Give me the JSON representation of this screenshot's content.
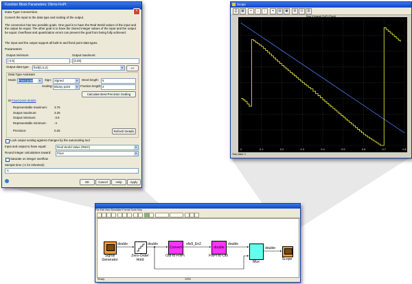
{
  "dialog": {
    "title": "Function Block Parameters: Obl-to-FixPt",
    "block_type": "Data Type Conversion",
    "description_1": "Convert the input to the data type and scaling of the output.",
    "description_2": "The conversion has two possible goals. One goal is to have the Real World values of the input and the output be equal. The other goal is to have the Stored Integer values of the input and the output be equal. Overflows and quantization errors can prevent the goal from being fully achieved.",
    "description_3": "The input and the output support all built-in and fixed point data types.",
    "parameters_label": "Parameters",
    "output_min_label": "Output minimum:",
    "output_min_value": "[-3.5]",
    "output_max_label": "Output maximum:",
    "output_max_value": "[3.25]",
    "data_type_label": "Output data type:",
    "data_type_value": "fixdt(1,5,2)",
    "data_type_btn": "<<",
    "assistant_label": "Data Type Assistant",
    "mode_label": "Mode:",
    "mode_value": "Fixed point",
    "sign_label": "Sign:",
    "sign_value": "Signed",
    "word_length_label": "Word length:",
    "word_length_value": "5",
    "scaling_label": "Scaling:",
    "scaling_value": "Binary point",
    "fraction_label": "Fraction length:",
    "fraction_value": "2",
    "calc_button": "Calculate Best-Precision Scaling",
    "fp_details_link": "Fixed-point details",
    "details": [
      {
        "label": "Representable maximum:",
        "value": "3.75"
      },
      {
        "label": "Output maximum:",
        "value": "3.25"
      },
      {
        "label": "Output minimum:",
        "value": "-3.5"
      },
      {
        "label": "Representable minimum:",
        "value": "-4"
      }
    ],
    "precision_label": "Precision:",
    "precision_value": "0.25",
    "refresh_button": "Refresh Details",
    "lock_label": "Lock output scaling against changes by the autoscaling tool",
    "equal_label": "Input and output to have equal:",
    "equal_value": "Real World Value (RWV)",
    "round_label": "Round integer calculations toward:",
    "round_value": "Floor",
    "saturate_label": "Saturate on integer overflow",
    "sample_label": "Sample time (-1 for inherited):",
    "sample_value": "-1",
    "ok": "OK",
    "cancel": "Cancel",
    "help": "Help",
    "apply": "Apply"
  },
  "scope": {
    "title": "Scope",
    "plot_title": "Real (Original)    FixPt (Fixed)"
  },
  "chart_data": {
    "type": "line",
    "title": "Real (Original)    FixPt (Fixed)",
    "xlim": [
      0,
      0.8
    ],
    "ylim": [
      -4,
      4
    ],
    "grid": true,
    "xticks": [
      "0",
      "0.1",
      "0.2",
      "0.3",
      "0.4",
      "0.5",
      "0.6",
      "0.7",
      "0.8"
    ],
    "series": [
      {
        "name": "Real (Original)",
        "color": "#4f7dff",
        "x": [
          0,
          0.8
        ],
        "y": [
          3.8,
          -3.2
        ]
      },
      {
        "name": "FixPt (Fixed)",
        "color": "#ffff40",
        "x": [
          0,
          0.02,
          0.04,
          0.052,
          0.1,
          0.2,
          0.3,
          0.34,
          0.365,
          0.4,
          0.5,
          0.6,
          0.682,
          0.7,
          0.78
        ],
        "y": [
          -1.0,
          -1.2,
          -1.5,
          2.75,
          2.3,
          1.1,
          0.0,
          -0.4,
          -0.7,
          -1.1,
          -2.2,
          -3.3,
          -4.0,
          3.5,
          2.6
        ]
      }
    ]
  },
  "model": {
    "menu": "File  Edit  View  Simulation  Format  Tools  Help",
    "status": "Ready",
    "status_right": "100%",
    "blocks": {
      "signal_generator": "Signal\nGenerator",
      "zoh": "Zero-Order\nHold",
      "convert_text": "Convert",
      "convert_label": "Obl-to-FixPt",
      "double_text": "double",
      "double_label": "FixPt-to-Obl",
      "mux_label": "Mux",
      "scope_label": "Scope"
    },
    "signals": {
      "s1": "double",
      "s2": "double",
      "s3": "sfix5_En2",
      "s4": "double",
      "s5": "double"
    }
  },
  "colors": {
    "dialog_bg": "#ece9d8",
    "titlebar": "#0a46c8",
    "block_magenta": "#ff33ff",
    "block_orange": "#ff9933",
    "block_cyan": "#66ffee"
  }
}
